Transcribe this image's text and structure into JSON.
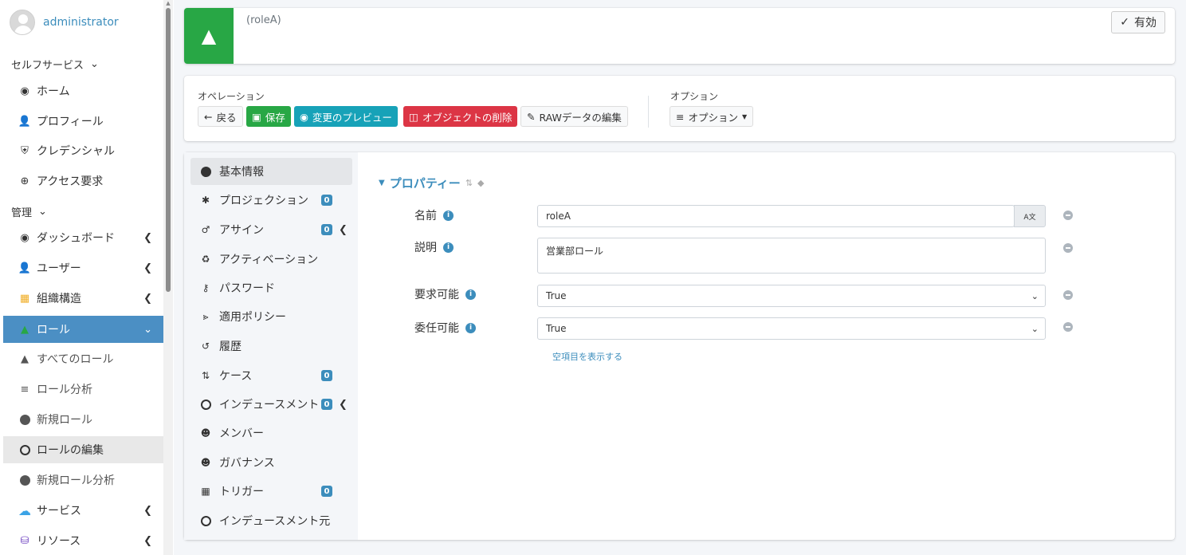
{
  "user": {
    "name": "administrator"
  },
  "sidebar": {
    "self_service_header": "セルフサービス",
    "admin_header": "管理",
    "self_items": [
      {
        "label": "ホーム",
        "icon": "dashboard-icon"
      },
      {
        "label": "プロフィール",
        "icon": "user-icon"
      },
      {
        "label": "クレデンシャル",
        "icon": "shield-icon"
      },
      {
        "label": "アクセス要求",
        "icon": "plus-circle-icon"
      }
    ],
    "admin_items": [
      {
        "label": "ダッシュボード",
        "icon": "dashboard-icon"
      },
      {
        "label": "ユーザー",
        "icon": "user-icon"
      },
      {
        "label": "組織構造",
        "icon": "building-icon"
      },
      {
        "label": "ロール",
        "icon": "role-icon"
      },
      {
        "label": "すべてのロール",
        "icon": "role-icon"
      },
      {
        "label": "ロール分析",
        "icon": "chart-icon"
      },
      {
        "label": "新規ロール",
        "icon": "plus-circle-icon"
      },
      {
        "label": "ロールの編集",
        "icon": "circle-icon"
      },
      {
        "label": "新規ロール分析",
        "icon": "plus-circle-icon"
      },
      {
        "label": "サービス",
        "icon": "cloud-icon"
      },
      {
        "label": "リソース",
        "icon": "database-icon"
      }
    ]
  },
  "header": {
    "object_name": "(roleA)",
    "status_label": "有効"
  },
  "operations": {
    "label": "オペレーション",
    "back": "戻る",
    "save": "保存",
    "preview": "変更のプレビュー",
    "delete": "オブジェクトの削除",
    "edit_raw": "RAWデータの編集",
    "options_label": "オプション",
    "options_button": "オプション"
  },
  "tabs": [
    {
      "label": "基本情報",
      "icon": "circle-filled-icon"
    },
    {
      "label": "プロジェクション",
      "icon": "person-icon",
      "badge": "0"
    },
    {
      "label": "アサイン",
      "icon": "gender-icon",
      "badge": "0"
    },
    {
      "label": "アクティベーション",
      "icon": "recycle-icon"
    },
    {
      "label": "パスワード",
      "icon": "key-icon"
    },
    {
      "label": "適用ポリシー",
      "icon": "share-icon"
    },
    {
      "label": "履歴",
      "icon": "history-icon"
    },
    {
      "label": "ケース",
      "icon": "case-icon",
      "badge": "0"
    },
    {
      "label": "インデュースメント",
      "icon": "circle-icon",
      "badge": "0"
    },
    {
      "label": "メンバー",
      "icon": "users-icon"
    },
    {
      "label": "ガバナンス",
      "icon": "users-icon"
    },
    {
      "label": "トリガー",
      "icon": "calendar-icon",
      "badge": "0"
    },
    {
      "label": "インデュースメント元",
      "icon": "circle-icon"
    }
  ],
  "properties": {
    "title": "プロパティー",
    "fields": [
      {
        "label": "名前",
        "value": "roleA",
        "addon": "A文"
      },
      {
        "label": "説明",
        "value": "営業部ロール"
      },
      {
        "label": "要求可能",
        "value": "True"
      },
      {
        "label": "委任可能",
        "value": "True"
      }
    ],
    "show_empty": "空項目を表示する"
  }
}
